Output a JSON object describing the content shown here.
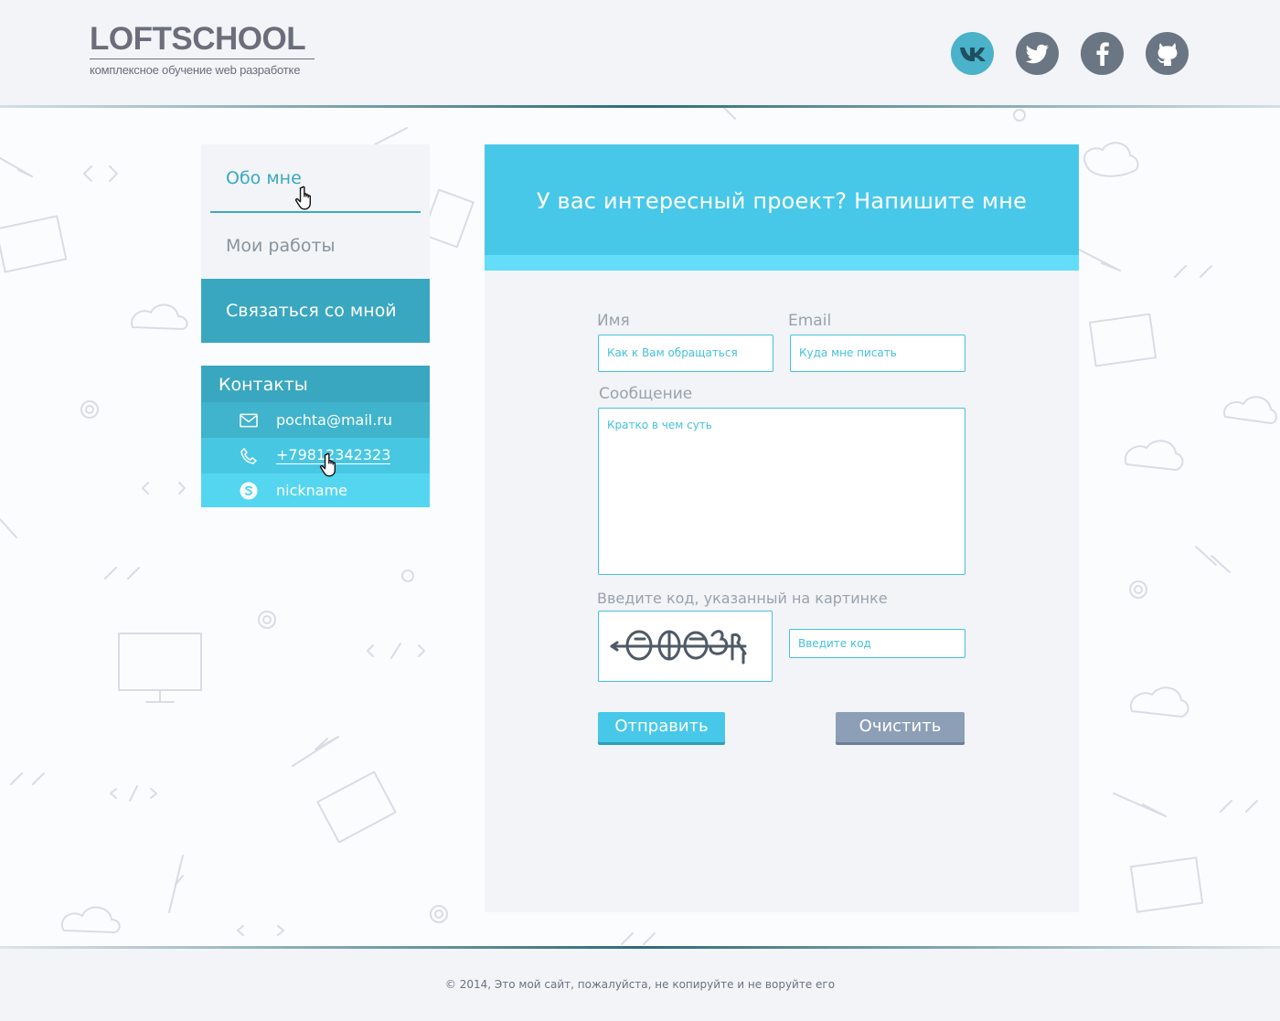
{
  "header": {
    "logo_title": "LOFTSCHOOL",
    "logo_subtitle": "комплексное обучение web разработке",
    "socials": [
      {
        "icon": "vk-icon",
        "color": "#4ab2c9"
      },
      {
        "icon": "twitter-icon",
        "color": "#6b7684"
      },
      {
        "icon": "facebook-icon",
        "color": "#6b7684"
      },
      {
        "icon": "github-icon",
        "color": "#6b7684"
      }
    ]
  },
  "nav": {
    "items": [
      {
        "label": "Обо мне"
      },
      {
        "label": "Мои работы"
      },
      {
        "label": "Связаться со мной"
      }
    ]
  },
  "contacts": {
    "title": "Контакты",
    "email": "pochta@mail.ru",
    "phone": "+79812342323",
    "skype": "nickname"
  },
  "form": {
    "heading": "У вас интересный проект? Напишите мне",
    "name_label": "Имя",
    "name_placeholder": "Как к Вам обращаться",
    "email_label": "Email",
    "email_placeholder": "Куда мне писать",
    "message_label": "Сообщение",
    "message_placeholder": "Кратко в чем суть",
    "captcha_label": "Введите код, указанный на картинке",
    "captcha_placeholder": "Введите код",
    "send_label": "Отправить",
    "clear_label": "Очистить"
  },
  "footer": {
    "text": "© 2014, Это мой сайт, пожалуйста, не копируйте и не воруйте его"
  },
  "colors": {
    "accent": "#48c8e8",
    "accent_dark": "#3aa7c0",
    "clear_button": "#8d9fb6"
  }
}
